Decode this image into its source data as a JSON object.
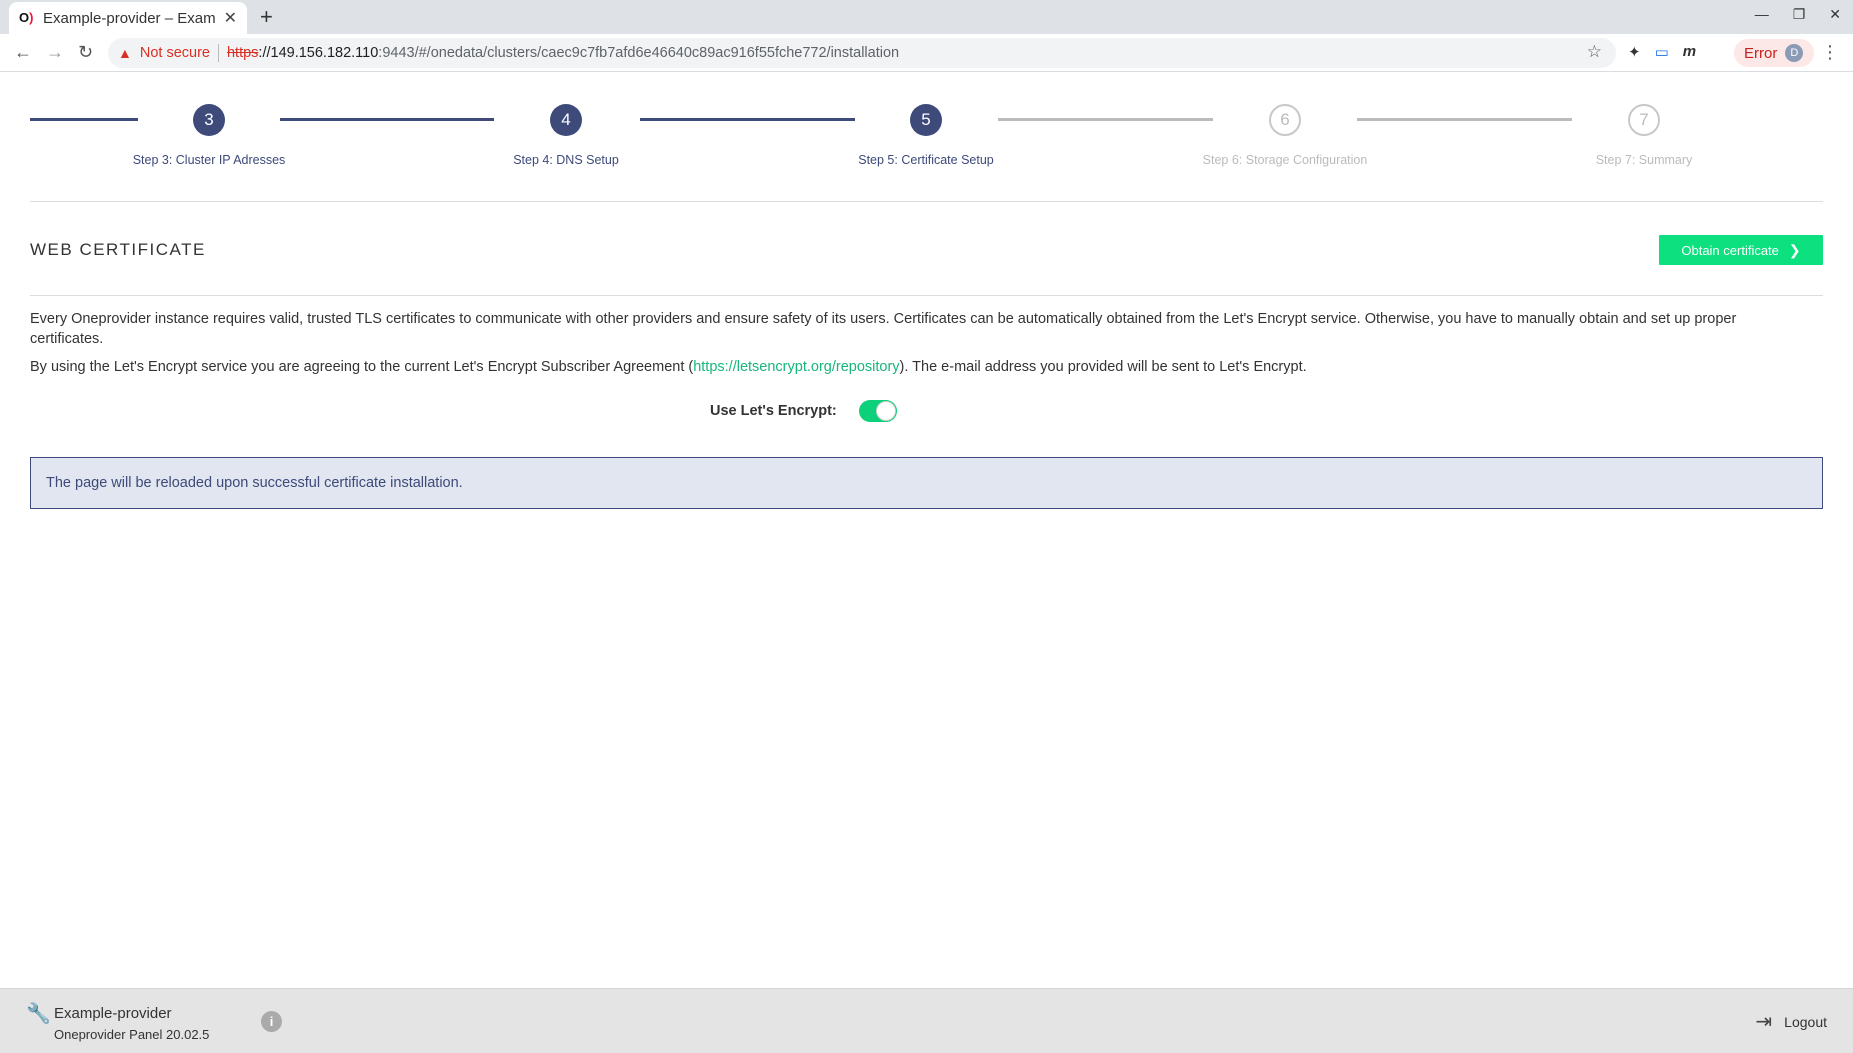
{
  "browser": {
    "tab_title": "Example-provider – Exam",
    "url_scheme": "https",
    "url_host": "://149.156.182.110",
    "url_path": ":9443/#/onedata/clusters/caec9c7fb7afd6e46640c89ac916f55fche772/installation",
    "not_secure": "Not secure",
    "error_label": "Error",
    "avatar_letter": "D"
  },
  "steps": [
    {
      "number": "3",
      "label": "Step 3: Cluster IP Adresses",
      "state": "done"
    },
    {
      "number": "4",
      "label": "Step 4: DNS Setup",
      "state": "done"
    },
    {
      "number": "5",
      "label": "Step 5: Certificate Setup",
      "state": "done"
    },
    {
      "number": "6",
      "label": "Step 6: Storage Configuration",
      "state": "todo"
    },
    {
      "number": "7",
      "label": "Step 7: Summary",
      "state": "todo"
    }
  ],
  "section": {
    "title": "WEB CERTIFICATE",
    "obtain_label": "Obtain certificate"
  },
  "description": {
    "p1": "Every Oneprovider instance requires valid, trusted TLS certificates to communicate with other providers and ensure safety of its users. Certificates can be automatically obtained from the Let's Encrypt service. Otherwise, you have to manually obtain and set up proper certificates.",
    "p2_before": "By using the Let's Encrypt service you are agreeing to the current Let's Encrypt Subscriber Agreement (",
    "p2_link": "https://letsencrypt.org/repository",
    "p2_after": "). The e-mail address you provided will be sent to Let's Encrypt."
  },
  "toggle": {
    "label": "Use Let's Encrypt:",
    "enabled": true
  },
  "info_box": "The page will be reloaded upon successful certificate installation.",
  "footer": {
    "provider_name": "Example-provider",
    "panel_version": "Oneprovider Panel 20.02.5",
    "logout_label": "Logout"
  },
  "colors": {
    "accent": "#3d4a7a",
    "success": "#0de07f"
  }
}
